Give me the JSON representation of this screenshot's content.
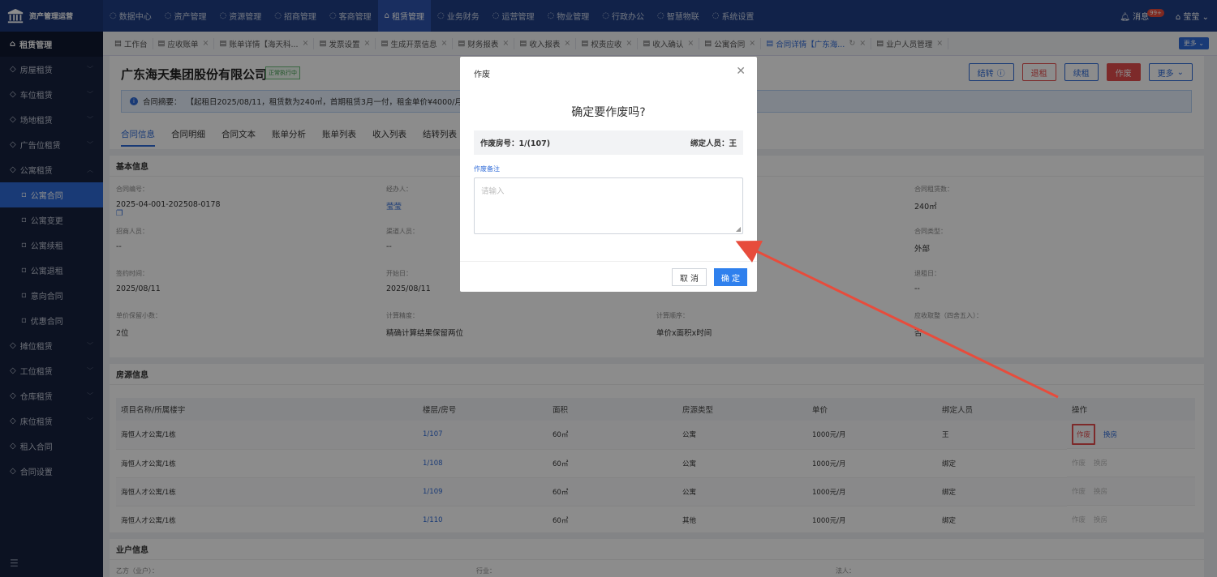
{
  "app": {
    "name": "资产管理运营"
  },
  "topnav": [
    {
      "label": "数据中心",
      "icon": "dashboard-icon"
    },
    {
      "label": "资产管理",
      "icon": "asset-icon"
    },
    {
      "label": "资源管理",
      "icon": "resource-icon"
    },
    {
      "label": "招商管理",
      "icon": "tag-icon"
    },
    {
      "label": "客商管理",
      "icon": "users-icon"
    },
    {
      "label": "租赁管理",
      "icon": "home-icon",
      "active": true
    },
    {
      "label": "业务财务",
      "icon": "finance-icon"
    },
    {
      "label": "运营管理",
      "icon": "ops-icon"
    },
    {
      "label": "物业管理",
      "icon": "property-icon"
    },
    {
      "label": "行政办公",
      "icon": "office-icon"
    },
    {
      "label": "智慧物联",
      "icon": "iot-icon"
    },
    {
      "label": "系统设置",
      "icon": "gear-icon"
    }
  ],
  "topright": {
    "messages": "消息",
    "badge": "99+",
    "user": "莹莹"
  },
  "sidebar": {
    "header": "租赁管理",
    "items": [
      {
        "label": "房屋租赁",
        "level": 1
      },
      {
        "label": "车位租赁",
        "level": 1
      },
      {
        "label": "场地租赁",
        "level": 1
      },
      {
        "label": "广告位租赁",
        "level": 1
      },
      {
        "label": "公寓租赁",
        "level": 1,
        "open": true
      },
      {
        "label": "公寓合同",
        "level": 2,
        "active": true
      },
      {
        "label": "公寓变更",
        "level": 2
      },
      {
        "label": "公寓续租",
        "level": 2
      },
      {
        "label": "公寓退租",
        "level": 2
      },
      {
        "label": "意向合同",
        "level": 2
      },
      {
        "label": "优惠合同",
        "level": 2
      },
      {
        "label": "摊位租赁",
        "level": 1
      },
      {
        "label": "工位租赁",
        "level": 1
      },
      {
        "label": "仓库租赁",
        "level": 1
      },
      {
        "label": "床位租赁",
        "level": 1
      },
      {
        "label": "租入合同",
        "level": 1
      },
      {
        "label": "合同设置",
        "level": 1
      }
    ]
  },
  "tabs": [
    {
      "label": "工作台"
    },
    {
      "label": "应收账单"
    },
    {
      "label": "账单详情【海天科..."
    },
    {
      "label": "发票设置"
    },
    {
      "label": "生成开票信息"
    },
    {
      "label": "财务报表"
    },
    {
      "label": "收入报表"
    },
    {
      "label": "权责应收"
    },
    {
      "label": "收入确认"
    },
    {
      "label": "公寓合同"
    },
    {
      "label": "合同详情【广东海...",
      "active": true
    },
    {
      "label": "业户人员管理"
    }
  ],
  "tabs_more": "更多",
  "page": {
    "company": "广东海天集团股份有限公司",
    "status": "正常执行中",
    "actions": {
      "transfer": "结转",
      "refund": "退租",
      "renew": "续租",
      "void": "作废",
      "more": "更多"
    },
    "summary_label": "合同摘要：",
    "summary": "【起租日2025/08/11，租赁数为240㎡，首期租赁3月一付，租金单价¥4000/月。",
    "subtabs": [
      "合同信息",
      "合同明细",
      "合同文本",
      "账单分析",
      "账单列表",
      "收入列表",
      "结转列表"
    ]
  },
  "basic": {
    "title": "基本信息",
    "fields": [
      {
        "label": "合同编号：",
        "value": "2025-04-001-202508-0178"
      },
      {
        "label": "经办人：",
        "value": "莹莹"
      },
      {
        "label": "合同租赁数：",
        "value": "240㎡"
      },
      {
        "label": "招商人员：",
        "value": "--"
      },
      {
        "label": "渠道人员：",
        "value": "--"
      },
      {
        "label": "合同类型：",
        "value": "外部"
      },
      {
        "label": "签约时间：",
        "value": "2025/08/11"
      },
      {
        "label": "开始日：",
        "value": "2025/08/11"
      },
      {
        "label": "退租日：",
        "value": "--"
      },
      {
        "label": "单价保留小数：",
        "value": "2位"
      },
      {
        "label": "计算精度：",
        "value": "精确计算结果保留两位"
      },
      {
        "label": "计算顺序：",
        "value": "单价x面积x时间"
      },
      {
        "label": "应收取整（四舍五入）：",
        "value": "否"
      }
    ]
  },
  "rooms": {
    "title": "房源信息",
    "headers": [
      "项目名称/所属楼宇",
      "楼层/房号",
      "面积",
      "房源类型",
      "单价",
      "绑定人员",
      "操作"
    ],
    "rows": [
      {
        "project": "海恒人才公寓/1栋",
        "room_floor": "1/",
        "room_no": "107",
        "area": "60㎡",
        "type": "公寓",
        "price": "1000元/月",
        "person": "王",
        "op1": "作废",
        "op2": "换房"
      },
      {
        "project": "海恒人才公寓/1栋",
        "room_floor": "1/",
        "room_no": "108",
        "area": "60㎡",
        "type": "公寓",
        "price": "1000元/月",
        "person": "绑定",
        "op1": "作废",
        "op2": "换房"
      },
      {
        "project": "海恒人才公寓/1栋",
        "room_floor": "1/",
        "room_no": "109",
        "area": "60㎡",
        "type": "公寓",
        "price": "1000元/月",
        "person": "绑定",
        "op1": "作废",
        "op2": "换房"
      },
      {
        "project": "海恒人才公寓/1栋",
        "room_floor": "1/",
        "room_no": "110",
        "area": "60㎡",
        "type": "其他",
        "price": "1000元/月",
        "person": "绑定",
        "op1": "作废",
        "op2": "换房"
      }
    ]
  },
  "owner": {
    "title": "业户信息",
    "f1": "乙方（业户）：",
    "f2": "行业：",
    "f3": "法人："
  },
  "modal": {
    "title": "作废",
    "question": "确定要作废吗?",
    "room_label": "作废房号：",
    "room_value": "1/(107)",
    "person_label": "绑定人员：",
    "person_value": "王",
    "note_label": "作废备注",
    "note_placeholder": "请输入",
    "cancel": "取 消",
    "ok": "确 定"
  },
  "colors": {
    "primary": "#2f6bd8",
    "danger": "#e34d4d",
    "topbar": "#1f3f86",
    "sidebar": "#16213e"
  }
}
